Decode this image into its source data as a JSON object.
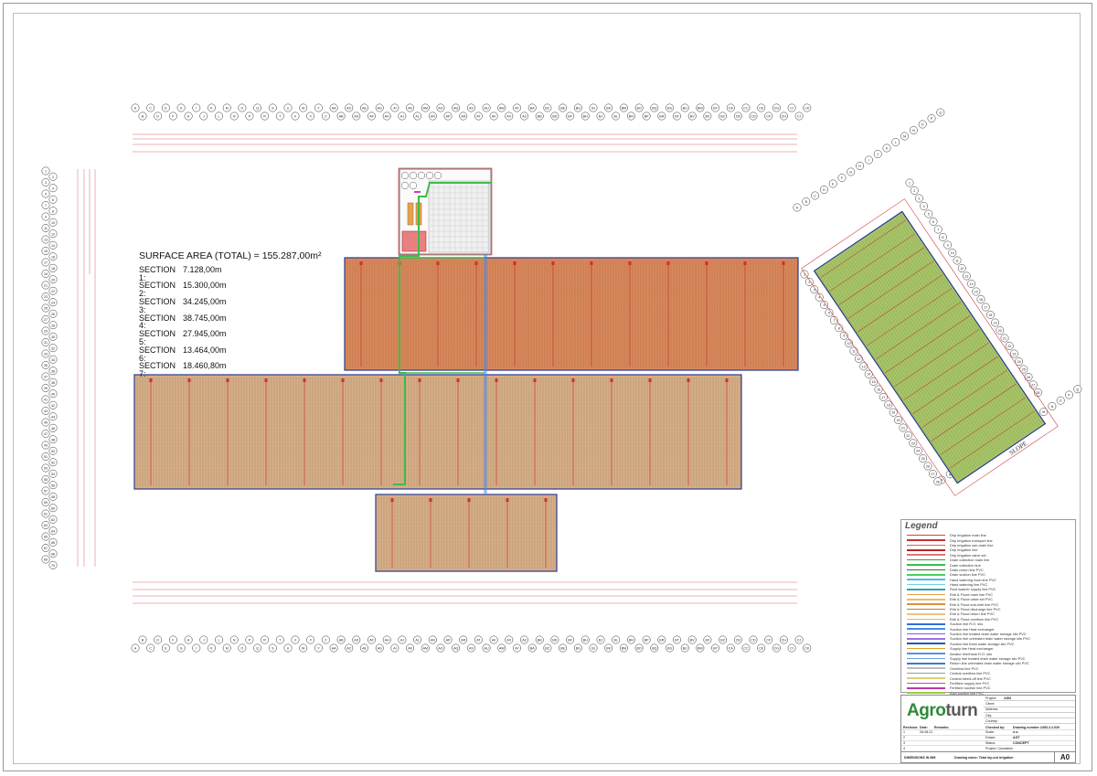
{
  "surface_area": {
    "title": "SURFACE AREA (TOTAL) = 155.287,00m²",
    "sections": [
      {
        "name": "SECTION 1:",
        "value": "7.128,00m"
      },
      {
        "name": "SECTION 2:",
        "value": "15.300,00m"
      },
      {
        "name": "SECTION 3:",
        "value": "34.245,00m"
      },
      {
        "name": "SECTION 4:",
        "value": "38.745,00m"
      },
      {
        "name": "SECTION 5:",
        "value": "27.945,00m"
      },
      {
        "name": "SECTION 6:",
        "value": "13.464,00m"
      },
      {
        "name": "SECTION 7:",
        "value": "18.460,80m"
      }
    ]
  },
  "legend": {
    "title": "Legend",
    "items": [
      {
        "label": "Drip irrigation main line",
        "color": "#d94040"
      },
      {
        "label": "Drip irrigation transport line",
        "color": "#c83232"
      },
      {
        "label": "Drip irrigation sub-main line",
        "color": "#e05a5a"
      },
      {
        "label": "Drip irrigation line",
        "color": "#b82626"
      },
      {
        "label": "Drip irrigation valve set",
        "color": "#e57373"
      },
      {
        "label": "Drain collection main line",
        "color": "#2e9e3e"
      },
      {
        "label": "Drain collection line",
        "color": "#3cbc4c"
      },
      {
        "label": "Drain return line PVC",
        "color": "#1f7a2c"
      },
      {
        "label": "Drain suction line PVC",
        "color": "#4bd05a"
      },
      {
        "label": "Hand watering main line PVC",
        "color": "#45c1d8"
      },
      {
        "label": "Hand watering line PVC",
        "color": "#6fd3e4"
      },
      {
        "label": "Roof washer supply line PVC",
        "color": "#2aa5bf"
      },
      {
        "label": "Ebb & Flood main line PVC",
        "color": "#e8a24c"
      },
      {
        "label": "Ebb & Flood valve set PVC",
        "color": "#f0b866"
      },
      {
        "label": "Ebb & Flood sub-inlet line PVC",
        "color": "#d6913a"
      },
      {
        "label": "Ebb & Flood discharge line PVC",
        "color": "#c07c2a"
      },
      {
        "label": "Ebb & Flood return line PVC",
        "color": "#f2c27e"
      },
      {
        "label": "Ebb & Flood overflow line PVC",
        "color": "#e9b060"
      },
      {
        "label": "Suction line R.O. silo",
        "color": "#2f6fd6"
      },
      {
        "label": "Suction line Heat exchanger",
        "color": "#4a86e8"
      },
      {
        "label": "Suction line treated drain water storage silo PVC",
        "color": "#8a5bd0"
      },
      {
        "label": "Suction line untreated drain water storage silo PVC",
        "color": "#a070e0"
      },
      {
        "label": "Suction line fresh water storage silo PVC",
        "color": "#1c57b8"
      },
      {
        "label": "Supply line Heat exchanger",
        "color": "#e0a020"
      },
      {
        "label": "Aerator line/Hose R.O. silo",
        "color": "#5c8fe0"
      },
      {
        "label": "Supply line treated drain water storage silo PVC",
        "color": "#6a9bea"
      },
      {
        "label": "Return line untreated drain water storage silo PVC",
        "color": "#3f78d8"
      },
      {
        "label": "Overflow line PVC",
        "color": "#bbbbbb"
      },
      {
        "label": "Central overflow line PVC",
        "color": "#999999"
      },
      {
        "label": "Central bleed-off line PVC",
        "color": "#d8d070"
      },
      {
        "label": "Fertilizer supply line PVC",
        "color": "#d040c0"
      },
      {
        "label": "Fertilizer suction line PVC",
        "color": "#b83aa8"
      },
      {
        "label": "Acid suction line PVC",
        "color": "#9acd32"
      },
      {
        "label": "Lye suction line PVC",
        "color": "#6a3aa8"
      }
    ]
  },
  "title_block": {
    "logo_part1": "Agro",
    "logo_part2": "turn",
    "fields": [
      {
        "key": "Project:",
        "value": "2453"
      },
      {
        "key": "Client:",
        "value": ""
      },
      {
        "key": "Address:",
        "value": ""
      },
      {
        "key": "City:",
        "value": ""
      },
      {
        "key": "Country:",
        "value": ""
      }
    ],
    "revision_header": {
      "rev": "Revision:",
      "date": "Date:",
      "remarks": "Remarks:",
      "checked": "Checked by:",
      "number_label": "Drawing number:",
      "number": "2453.2.2.020"
    },
    "revisions": [
      {
        "rev": "1",
        "date": "26-08-21",
        "k": "Scale:",
        "v": "n.s."
      },
      {
        "rev": "2",
        "date": "",
        "k": "Drawn:",
        "v": "AGT"
      },
      {
        "rev": "3",
        "date": "",
        "k": "Status:",
        "v": "CONCEPT"
      },
      {
        "rev": "4",
        "date": "",
        "k": "Project / Quotation",
        "v": ""
      }
    ],
    "dimensions_note": "DIMENSIONS IN MM",
    "drawing_name": "Drawing name: Total lay-out irrigation",
    "sheet_size": "A0"
  },
  "grid_labels": {
    "top_row1": [
      "A",
      "C",
      "E",
      "G",
      "I",
      "K",
      "M",
      "O",
      "Q",
      "S",
      "U",
      "W",
      "Y",
      "AA",
      "AC",
      "AE",
      "AG",
      "AI",
      "AK",
      "AM",
      "AO",
      "AQ",
      "AS",
      "AU",
      "AW",
      "AY",
      "BA",
      "BC",
      "BE",
      "BG",
      "BI",
      "BK",
      "BM",
      "BO",
      "BQ",
      "BS",
      "BU",
      "BW",
      "BY",
      "CA",
      "CC",
      "CE",
      "CG",
      "CI",
      "CK"
    ],
    "top_row2": [
      "B",
      "D",
      "F",
      "H",
      "J",
      "L",
      "N",
      "P",
      "R",
      "T",
      "V",
      "X",
      "Z",
      "AB",
      "AD",
      "AF",
      "AH",
      "AJ",
      "AL",
      "AN",
      "AP",
      "AR",
      "AT",
      "AV",
      "AX",
      "AZ",
      "BB",
      "BD",
      "BF",
      "BH",
      "BJ",
      "BL",
      "BN",
      "BP",
      "BR",
      "BT",
      "BV",
      "BX",
      "BZ",
      "CB",
      "CD",
      "CF",
      "CH",
      "CJ"
    ],
    "left_col": [
      "1",
      "2",
      "3",
      "4",
      "5",
      "6",
      "7",
      "8",
      "9",
      "10",
      "11",
      "12",
      "13",
      "14",
      "15",
      "16",
      "17",
      "18",
      "19",
      "20",
      "21",
      "22",
      "23",
      "24",
      "25",
      "26",
      "27",
      "28",
      "29",
      "30",
      "31",
      "32",
      "33",
      "34",
      "35",
      "36",
      "37",
      "38",
      "39",
      "40",
      "41",
      "42",
      "43",
      "44",
      "45",
      "46",
      "47",
      "48",
      "49",
      "50",
      "51",
      "52",
      "53",
      "54",
      "55",
      "56",
      "57",
      "58",
      "59",
      "60",
      "61",
      "62",
      "63",
      "64",
      "65",
      "66",
      "67",
      "68",
      "69",
      "70"
    ],
    "slope_label": "SLOPE"
  },
  "colors": {
    "orange_section": "#d9885a",
    "tan_section": "#d8b088",
    "green_section": "#a8c46a",
    "drain_line": "#3cbc4c",
    "border_blue": "#2a3a8c",
    "dim_red": "#d04040"
  }
}
